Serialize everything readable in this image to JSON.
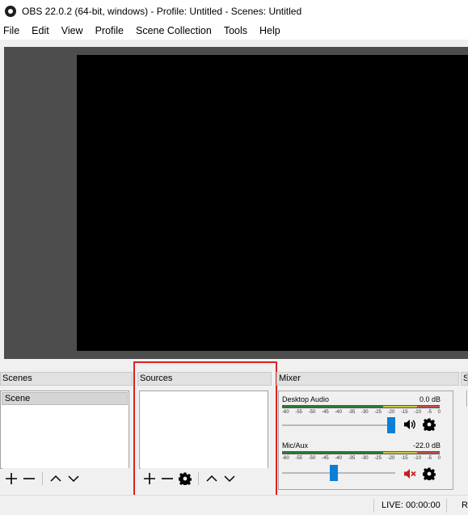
{
  "window": {
    "title": "OBS 22.0.2 (64-bit, windows) - Profile: Untitled - Scenes: Untitled",
    "icon": "obs-logo-icon"
  },
  "menu": [
    "File",
    "Edit",
    "View",
    "Profile",
    "Scene Collection",
    "Tools",
    "Help"
  ],
  "scenes": {
    "header": "Scenes",
    "items": [
      "Scene"
    ]
  },
  "sources": {
    "header": "Sources",
    "items": []
  },
  "mixer": {
    "header": "Mixer",
    "scale": [
      "-60",
      "-55",
      "-50",
      "-45",
      "-40",
      "-35",
      "-30",
      "-25",
      "-20",
      "-15",
      "-10",
      "-5",
      "0"
    ],
    "channels": [
      {
        "name": "Desktop Audio",
        "db": "0.0 dB",
        "volume": 1.0,
        "muted": false,
        "icon": "speaker-icon"
      },
      {
        "name": "Mic/Aux",
        "db": "-22.0 dB",
        "volume": 0.45,
        "muted": true,
        "icon": "muted-speaker-icon"
      }
    ]
  },
  "partial_dock": {
    "header": "S"
  },
  "status": {
    "live": "LIVE: 00:00:00",
    "rec": "R"
  },
  "colors": {
    "highlight": "#e02020",
    "slider": "#0a7fd8",
    "mute": "#c41e1e",
    "preview_bg": "#4d4d4d",
    "canvas": "#000000"
  }
}
